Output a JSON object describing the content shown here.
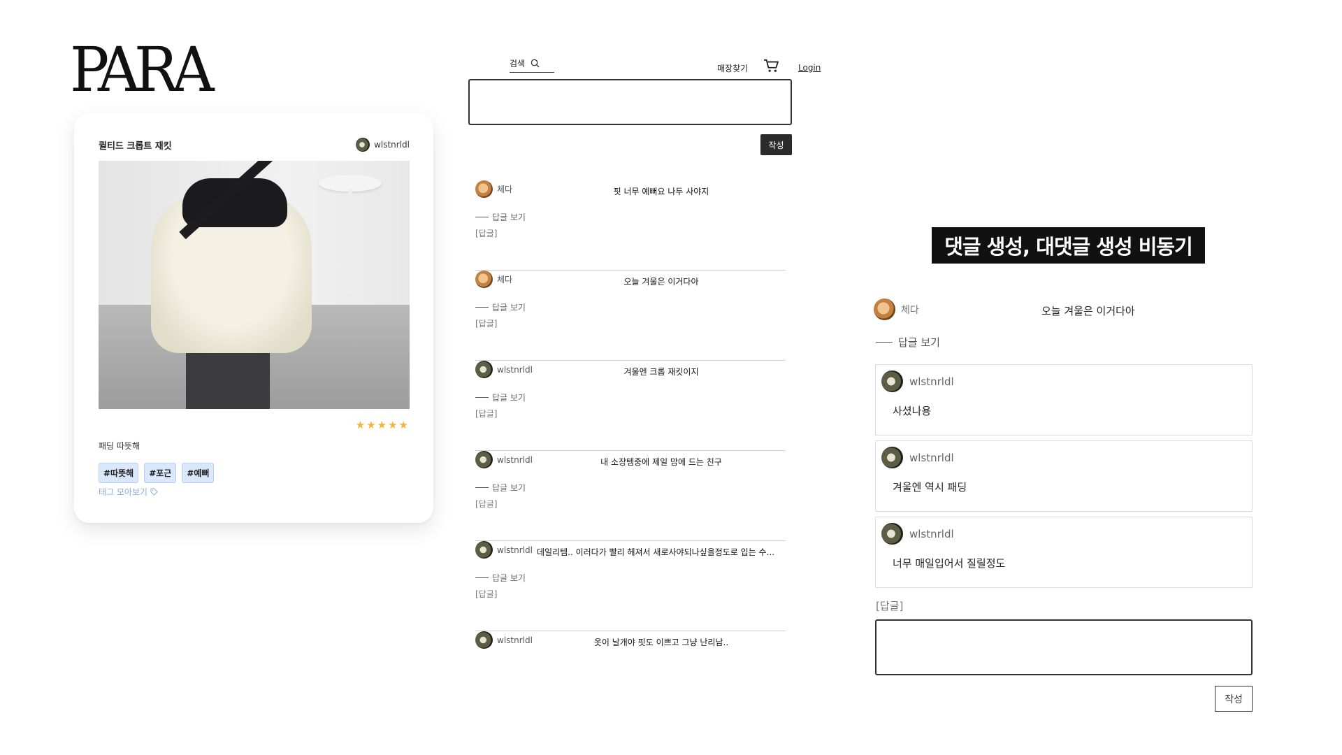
{
  "logo": "PARA",
  "post": {
    "title": "퀼티드 크롭트 재킷",
    "username": "wlstnrldl",
    "rating": 5,
    "stars": "★★★★★",
    "description": "패딩  따뜻해",
    "tags": [
      "#따뜻해",
      "#포근",
      "#예뻐"
    ],
    "tag_more": "태그 모아보기"
  },
  "header": {
    "search_label": "검색",
    "store_label": "매장찾기",
    "login_label": "Login"
  },
  "comment_form": {
    "submit_label": "작성"
  },
  "comments": [
    {
      "user": "체다",
      "avatar": "dog",
      "text": "핏 너무 예뻐요 나두 사야지",
      "view_replies": "답글 보기",
      "reply": "[답글]"
    },
    {
      "user": "체다",
      "avatar": "dog",
      "text": "오늘 겨울은 이거다아",
      "view_replies": "답글 보기",
      "reply": "[답글]"
    },
    {
      "user": "wlstnrldl",
      "avatar": "cat",
      "text": "겨울엔 크롭 재킷이지",
      "view_replies": "답글 보기",
      "reply": "[답글]"
    },
    {
      "user": "wlstnrldl",
      "avatar": "cat",
      "text": "내 소장템중에 제일 맘에 드는 친구",
      "view_replies": "답글 보기",
      "reply": "[답글]"
    },
    {
      "user": "wlstnrldl",
      "avatar": "cat",
      "text": "데일리템.. 이러다가 빨리 헤져서 새로사야되나싶을정도로 입는 수...",
      "view_replies": "답글 보기",
      "reply": "[답글]"
    },
    {
      "user": "wlstnrldl",
      "avatar": "cat",
      "text": "옷이 날개야 핏도 이쁘고 그냥 난리남..",
      "view_replies": "",
      "reply": ""
    }
  ],
  "detail": {
    "banner": "댓글 생성, 대댓글 생성 비동기",
    "comment": {
      "user": "체다",
      "text": "오늘 겨울은 이거다아",
      "view_replies": "답글 보기"
    },
    "replies": [
      {
        "user": "wlstnrldl",
        "text": "사셨나용"
      },
      {
        "user": "wlstnrldl",
        "text": "겨울엔 역시 패딩"
      },
      {
        "user": "wlstnrldl",
        "text": "너무 매일입어서 질릴정도"
      }
    ],
    "reply_label": "[답글]",
    "submit_label": "작성"
  },
  "colors": {
    "star": "#f5b33a",
    "tag_bg": "#dbe7fb",
    "tag_more": "#8aa9dd",
    "button_dark": "#2b2b2b"
  },
  "icons": [
    "search-icon",
    "cart-icon",
    "tag-icon",
    "star-icon"
  ]
}
